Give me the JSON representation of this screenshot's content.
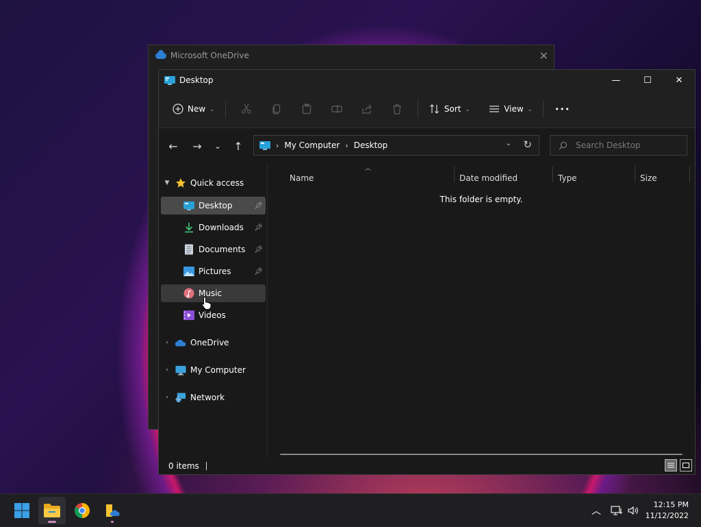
{
  "background_window": {
    "title": "Microsoft OneDrive",
    "close": "✕"
  },
  "window": {
    "title": "Desktop",
    "minimize": "—",
    "maximize": "☐",
    "close": "✕"
  },
  "toolbar": {
    "new_label": "New",
    "sort_label": "Sort",
    "view_label": "View",
    "more_label": "•••",
    "icons": [
      "cut-icon",
      "copy-icon",
      "paste-icon",
      "rename-icon",
      "share-icon",
      "delete-icon"
    ]
  },
  "nav": {
    "back": "←",
    "forward": "→",
    "recent": "⌄",
    "up": "↑"
  },
  "address": {
    "segments": [
      "My Computer",
      "Desktop"
    ],
    "separator": "›"
  },
  "search": {
    "placeholder": "Search Desktop"
  },
  "sidebar": {
    "quick_access": "Quick access",
    "quick_items": [
      {
        "label": "Desktop",
        "icon": "desktop-icon",
        "pinned": true,
        "selected": true
      },
      {
        "label": "Downloads",
        "icon": "downloads-icon",
        "pinned": true
      },
      {
        "label": "Documents",
        "icon": "documents-icon",
        "pinned": true
      },
      {
        "label": "Pictures",
        "icon": "pictures-icon",
        "pinned": true
      },
      {
        "label": "Music",
        "icon": "music-icon",
        "hovered": true
      },
      {
        "label": "Videos",
        "icon": "videos-icon"
      }
    ],
    "roots": [
      {
        "label": "OneDrive",
        "icon": "onedrive-icon"
      },
      {
        "label": "My Computer",
        "icon": "computer-icon"
      },
      {
        "label": "Network",
        "icon": "network-icon"
      }
    ]
  },
  "columns": {
    "name": "Name",
    "date": "Date modified",
    "type": "Type",
    "size": "Size"
  },
  "empty_message": "This folder is empty.",
  "status": {
    "items": "0 items"
  },
  "taskbar": {
    "apps": [
      "start-icon",
      "file-explorer-icon",
      "chrome-icon",
      "onedrive-folder-icon"
    ]
  },
  "clock": {
    "time": "12:15 PM",
    "date": "11/12/2022"
  },
  "colors": {
    "accent": "#2d7fd3",
    "selected": "#4a4a4a",
    "window_bg": "#191919"
  }
}
